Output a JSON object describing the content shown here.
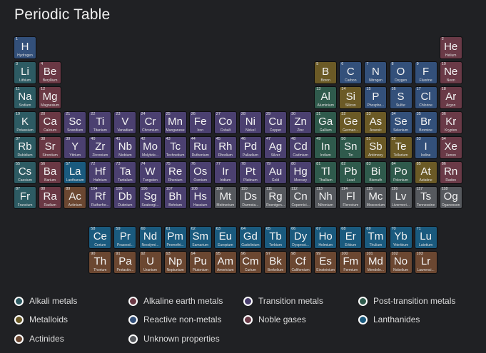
{
  "page": {
    "title": "Periodic Table"
  },
  "colors": {
    "alkali": "#2d5b63",
    "alkaline": "#6a3844",
    "transition": "#4b4070",
    "post": "#2f5a4c",
    "metalloid": "#6b5a26",
    "nonmetal": "#33507a",
    "noble": "#6a3a47",
    "lanthanide": "#1a5a7e",
    "actinide": "#6b4731",
    "unknown": "#56595e"
  },
  "legend": [
    {
      "label": "Alkali metals",
      "category": "alkali"
    },
    {
      "label": "Alkaline earth metals",
      "category": "alkaline"
    },
    {
      "label": "Transition metals",
      "category": "transition"
    },
    {
      "label": "Post-transition metals",
      "category": "post"
    },
    {
      "label": "Metalloids",
      "category": "metalloid"
    },
    {
      "label": "Reactive non-metals",
      "category": "nonmetal"
    },
    {
      "label": "Noble gases",
      "category": "noble"
    },
    {
      "label": "Lanthanides",
      "category": "lanthanide"
    },
    {
      "label": "Actinides",
      "category": "actinide"
    },
    {
      "label": "Unknown properties",
      "category": "unknown"
    }
  ],
  "elements": [
    {
      "n": 1,
      "s": "H",
      "name": "Hydrogen",
      "g": 1,
      "p": 1,
      "c": "nonmetal"
    },
    {
      "n": 2,
      "s": "He",
      "name": "Helium",
      "g": 18,
      "p": 1,
      "c": "noble"
    },
    {
      "n": 3,
      "s": "Li",
      "name": "Lithium",
      "g": 1,
      "p": 2,
      "c": "alkali"
    },
    {
      "n": 4,
      "s": "Be",
      "name": "Beryllium",
      "g": 2,
      "p": 2,
      "c": "alkaline"
    },
    {
      "n": 5,
      "s": "B",
      "name": "Boron",
      "g": 13,
      "p": 2,
      "c": "metalloid"
    },
    {
      "n": 6,
      "s": "C",
      "name": "Carbon",
      "g": 14,
      "p": 2,
      "c": "nonmetal"
    },
    {
      "n": 7,
      "s": "N",
      "name": "Nitrogen",
      "g": 15,
      "p": 2,
      "c": "nonmetal"
    },
    {
      "n": 8,
      "s": "O",
      "name": "Oxygen",
      "g": 16,
      "p": 2,
      "c": "nonmetal"
    },
    {
      "n": 9,
      "s": "F",
      "name": "Fluorine",
      "g": 17,
      "p": 2,
      "c": "nonmetal"
    },
    {
      "n": 10,
      "s": "Ne",
      "name": "Neon",
      "g": 18,
      "p": 2,
      "c": "noble"
    },
    {
      "n": 11,
      "s": "Na",
      "name": "Sodium",
      "g": 1,
      "p": 3,
      "c": "alkali"
    },
    {
      "n": 12,
      "s": "Mg",
      "name": "Magnesium",
      "g": 2,
      "p": 3,
      "c": "alkaline"
    },
    {
      "n": 13,
      "s": "Al",
      "name": "Aluminium",
      "g": 13,
      "p": 3,
      "c": "post"
    },
    {
      "n": 14,
      "s": "Si",
      "name": "Silicon",
      "g": 14,
      "p": 3,
      "c": "metalloid"
    },
    {
      "n": 15,
      "s": "P",
      "name": "Phospho...",
      "g": 15,
      "p": 3,
      "c": "nonmetal"
    },
    {
      "n": 16,
      "s": "S",
      "name": "Sulfur",
      "g": 16,
      "p": 3,
      "c": "nonmetal"
    },
    {
      "n": 17,
      "s": "Cl",
      "name": "Chlorine",
      "g": 17,
      "p": 3,
      "c": "nonmetal"
    },
    {
      "n": 18,
      "s": "Ar",
      "name": "Argon",
      "g": 18,
      "p": 3,
      "c": "noble"
    },
    {
      "n": 19,
      "s": "K",
      "name": "Potassium",
      "g": 1,
      "p": 4,
      "c": "alkali"
    },
    {
      "n": 20,
      "s": "Ca",
      "name": "Calcium",
      "g": 2,
      "p": 4,
      "c": "alkaline"
    },
    {
      "n": 21,
      "s": "Sc",
      "name": "Scandium",
      "g": 3,
      "p": 4,
      "c": "transition"
    },
    {
      "n": 22,
      "s": "Ti",
      "name": "Titanium",
      "g": 4,
      "p": 4,
      "c": "transition"
    },
    {
      "n": 23,
      "s": "V",
      "name": "Vanadium",
      "g": 5,
      "p": 4,
      "c": "transition"
    },
    {
      "n": 24,
      "s": "Cr",
      "name": "Chromium",
      "g": 6,
      "p": 4,
      "c": "transition"
    },
    {
      "n": 25,
      "s": "Mn",
      "name": "Manganese",
      "g": 7,
      "p": 4,
      "c": "transition"
    },
    {
      "n": 26,
      "s": "Fe",
      "name": "Iron",
      "g": 8,
      "p": 4,
      "c": "transition"
    },
    {
      "n": 27,
      "s": "Co",
      "name": "Cobalt",
      "g": 9,
      "p": 4,
      "c": "transition"
    },
    {
      "n": 28,
      "s": "Ni",
      "name": "Nickel",
      "g": 10,
      "p": 4,
      "c": "transition"
    },
    {
      "n": 29,
      "s": "Cu",
      "name": "Copper",
      "g": 11,
      "p": 4,
      "c": "transition"
    },
    {
      "n": 30,
      "s": "Zn",
      "name": "Zinc",
      "g": 12,
      "p": 4,
      "c": "transition"
    },
    {
      "n": 31,
      "s": "Ga",
      "name": "Gallium",
      "g": 13,
      "p": 4,
      "c": "post"
    },
    {
      "n": 32,
      "s": "Ge",
      "name": "German...",
      "g": 14,
      "p": 4,
      "c": "metalloid"
    },
    {
      "n": 33,
      "s": "As",
      "name": "Arsenic",
      "g": 15,
      "p": 4,
      "c": "metalloid"
    },
    {
      "n": 34,
      "s": "Se",
      "name": "Selenium",
      "g": 16,
      "p": 4,
      "c": "nonmetal"
    },
    {
      "n": 35,
      "s": "Br",
      "name": "Bromine",
      "g": 17,
      "p": 4,
      "c": "nonmetal"
    },
    {
      "n": 36,
      "s": "Kr",
      "name": "Krypton",
      "g": 18,
      "p": 4,
      "c": "noble"
    },
    {
      "n": 37,
      "s": "Rb",
      "name": "Rubidium",
      "g": 1,
      "p": 5,
      "c": "alkali"
    },
    {
      "n": 38,
      "s": "Sr",
      "name": "Strontium",
      "g": 2,
      "p": 5,
      "c": "alkaline"
    },
    {
      "n": 39,
      "s": "Y",
      "name": "Yttrium",
      "g": 3,
      "p": 5,
      "c": "transition"
    },
    {
      "n": 40,
      "s": "Zr",
      "name": "Zirconium",
      "g": 4,
      "p": 5,
      "c": "transition"
    },
    {
      "n": 41,
      "s": "Nb",
      "name": "Niobium",
      "g": 5,
      "p": 5,
      "c": "transition"
    },
    {
      "n": 42,
      "s": "Mo",
      "name": "Molybde...",
      "g": 6,
      "p": 5,
      "c": "transition"
    },
    {
      "n": 43,
      "s": "Tc",
      "name": "Technetium",
      "g": 7,
      "p": 5,
      "c": "transition"
    },
    {
      "n": 44,
      "s": "Ru",
      "name": "Ruthenium",
      "g": 8,
      "p": 5,
      "c": "transition"
    },
    {
      "n": 45,
      "s": "Rh",
      "name": "Rhodium",
      "g": 9,
      "p": 5,
      "c": "transition"
    },
    {
      "n": 46,
      "s": "Pd",
      "name": "Palladium",
      "g": 10,
      "p": 5,
      "c": "transition"
    },
    {
      "n": 47,
      "s": "Ag",
      "name": "Silver",
      "g": 11,
      "p": 5,
      "c": "transition"
    },
    {
      "n": 48,
      "s": "Cd",
      "name": "Cadmium",
      "g": 12,
      "p": 5,
      "c": "transition"
    },
    {
      "n": 49,
      "s": "In",
      "name": "Indium",
      "g": 13,
      "p": 5,
      "c": "post"
    },
    {
      "n": 50,
      "s": "Sn",
      "name": "Tin",
      "g": 14,
      "p": 5,
      "c": "post"
    },
    {
      "n": 51,
      "s": "Sb",
      "name": "Antimony",
      "g": 15,
      "p": 5,
      "c": "metalloid"
    },
    {
      "n": 52,
      "s": "Te",
      "name": "Tellurium",
      "g": 16,
      "p": 5,
      "c": "metalloid"
    },
    {
      "n": 53,
      "s": "I",
      "name": "Iodine",
      "g": 17,
      "p": 5,
      "c": "nonmetal"
    },
    {
      "n": 54,
      "s": "Xe",
      "name": "Xenon",
      "g": 18,
      "p": 5,
      "c": "noble"
    },
    {
      "n": 55,
      "s": "Cs",
      "name": "Caesium",
      "g": 1,
      "p": 6,
      "c": "alkali"
    },
    {
      "n": 56,
      "s": "Ba",
      "name": "Barium",
      "g": 2,
      "p": 6,
      "c": "alkaline"
    },
    {
      "n": 57,
      "s": "La",
      "name": "Lanthanum",
      "g": 3,
      "p": 6,
      "c": "lanthanide"
    },
    {
      "n": 72,
      "s": "Hf",
      "name": "Hafnium",
      "g": 4,
      "p": 6,
      "c": "transition"
    },
    {
      "n": 73,
      "s": "Ta",
      "name": "Tantalum",
      "g": 5,
      "p": 6,
      "c": "transition"
    },
    {
      "n": 74,
      "s": "W",
      "name": "Tungsten",
      "g": 6,
      "p": 6,
      "c": "transition"
    },
    {
      "n": 75,
      "s": "Re",
      "name": "Rhenium",
      "g": 7,
      "p": 6,
      "c": "transition"
    },
    {
      "n": 76,
      "s": "Os",
      "name": "Osmium",
      "g": 8,
      "p": 6,
      "c": "transition"
    },
    {
      "n": 77,
      "s": "Ir",
      "name": "Iridium",
      "g": 9,
      "p": 6,
      "c": "transition"
    },
    {
      "n": 78,
      "s": "Pt",
      "name": "Platinum",
      "g": 10,
      "p": 6,
      "c": "transition"
    },
    {
      "n": 79,
      "s": "Au",
      "name": "Gold",
      "g": 11,
      "p": 6,
      "c": "transition"
    },
    {
      "n": 80,
      "s": "Hg",
      "name": "Mercury",
      "g": 12,
      "p": 6,
      "c": "transition"
    },
    {
      "n": 81,
      "s": "Tl",
      "name": "Thallium",
      "g": 13,
      "p": 6,
      "c": "post"
    },
    {
      "n": 82,
      "s": "Pb",
      "name": "Lead",
      "g": 14,
      "p": 6,
      "c": "post"
    },
    {
      "n": 83,
      "s": "Bi",
      "name": "Bismuth",
      "g": 15,
      "p": 6,
      "c": "post"
    },
    {
      "n": 84,
      "s": "Po",
      "name": "Polonium",
      "g": 16,
      "p": 6,
      "c": "post"
    },
    {
      "n": 85,
      "s": "At",
      "name": "Astatine",
      "g": 17,
      "p": 6,
      "c": "metalloid"
    },
    {
      "n": 86,
      "s": "Rn",
      "name": "Radon",
      "g": 18,
      "p": 6,
      "c": "noble"
    },
    {
      "n": 87,
      "s": "Fr",
      "name": "Francium",
      "g": 1,
      "p": 7,
      "c": "alkali"
    },
    {
      "n": 88,
      "s": "Ra",
      "name": "Radium",
      "g": 2,
      "p": 7,
      "c": "alkaline"
    },
    {
      "n": 89,
      "s": "Ac",
      "name": "Actinium",
      "g": 3,
      "p": 7,
      "c": "actinide"
    },
    {
      "n": 104,
      "s": "Rf",
      "name": "Rutherfor...",
      "g": 4,
      "p": 7,
      "c": "transition"
    },
    {
      "n": 105,
      "s": "Db",
      "name": "Dubnium",
      "g": 5,
      "p": 7,
      "c": "transition"
    },
    {
      "n": 106,
      "s": "Sg",
      "name": "Seaborgi...",
      "g": 6,
      "p": 7,
      "c": "transition"
    },
    {
      "n": 107,
      "s": "Bh",
      "name": "Bohrium",
      "g": 7,
      "p": 7,
      "c": "transition"
    },
    {
      "n": 108,
      "s": "Hs",
      "name": "Hassium",
      "g": 8,
      "p": 7,
      "c": "transition"
    },
    {
      "n": 109,
      "s": "Mt",
      "name": "Meitnerium",
      "g": 9,
      "p": 7,
      "c": "unknown"
    },
    {
      "n": 110,
      "s": "Ds",
      "name": "Darmsta...",
      "g": 10,
      "p": 7,
      "c": "unknown"
    },
    {
      "n": 111,
      "s": "Rg",
      "name": "Roentgen...",
      "g": 11,
      "p": 7,
      "c": "unknown"
    },
    {
      "n": 112,
      "s": "Cn",
      "name": "Copernici...",
      "g": 12,
      "p": 7,
      "c": "unknown"
    },
    {
      "n": 113,
      "s": "Nh",
      "name": "Nihonium",
      "g": 13,
      "p": 7,
      "c": "unknown"
    },
    {
      "n": 114,
      "s": "Fl",
      "name": "Flerovium",
      "g": 14,
      "p": 7,
      "c": "unknown"
    },
    {
      "n": 115,
      "s": "Mc",
      "name": "Moscovium",
      "g": 15,
      "p": 7,
      "c": "unknown"
    },
    {
      "n": 116,
      "s": "Lv",
      "name": "Livermori...",
      "g": 16,
      "p": 7,
      "c": "unknown"
    },
    {
      "n": 117,
      "s": "Ts",
      "name": "Tennessine",
      "g": 17,
      "p": 7,
      "c": "unknown"
    },
    {
      "n": 118,
      "s": "Og",
      "name": "Oganesson",
      "g": 18,
      "p": 7,
      "c": "unknown"
    },
    {
      "n": 58,
      "s": "Ce",
      "name": "Cerium",
      "g": 4,
      "p": 9,
      "c": "lanthanide"
    },
    {
      "n": 59,
      "s": "Pr",
      "name": "Praseod...",
      "g": 5,
      "p": 9,
      "c": "lanthanide"
    },
    {
      "n": 60,
      "s": "Nd",
      "name": "Neodymi...",
      "g": 6,
      "p": 9,
      "c": "lanthanide"
    },
    {
      "n": 61,
      "s": "Pm",
      "name": "Promethi...",
      "g": 7,
      "p": 9,
      "c": "lanthanide"
    },
    {
      "n": 62,
      "s": "Sm",
      "name": "Samarium",
      "g": 8,
      "p": 9,
      "c": "lanthanide"
    },
    {
      "n": 63,
      "s": "Eu",
      "name": "Europium",
      "g": 9,
      "p": 9,
      "c": "lanthanide"
    },
    {
      "n": 64,
      "s": "Gd",
      "name": "Gadolinium",
      "g": 10,
      "p": 9,
      "c": "lanthanide"
    },
    {
      "n": 65,
      "s": "Tb",
      "name": "Terbium",
      "g": 11,
      "p": 9,
      "c": "lanthanide"
    },
    {
      "n": 66,
      "s": "Dy",
      "name": "Dysprosi...",
      "g": 12,
      "p": 9,
      "c": "lanthanide"
    },
    {
      "n": 67,
      "s": "Ho",
      "name": "Holmium",
      "g": 13,
      "p": 9,
      "c": "lanthanide"
    },
    {
      "n": 68,
      "s": "Er",
      "name": "Erbium",
      "g": 14,
      "p": 9,
      "c": "lanthanide"
    },
    {
      "n": 69,
      "s": "Tm",
      "name": "Thulium",
      "g": 15,
      "p": 9,
      "c": "lanthanide"
    },
    {
      "n": 70,
      "s": "Yb",
      "name": "Ytterbium",
      "g": 16,
      "p": 9,
      "c": "lanthanide"
    },
    {
      "n": 71,
      "s": "Lu",
      "name": "Lutetium",
      "g": 17,
      "p": 9,
      "c": "lanthanide"
    },
    {
      "n": 90,
      "s": "Th",
      "name": "Thorium",
      "g": 4,
      "p": 10,
      "c": "actinide"
    },
    {
      "n": 91,
      "s": "Pa",
      "name": "Protactin...",
      "g": 5,
      "p": 10,
      "c": "actinide"
    },
    {
      "n": 92,
      "s": "U",
      "name": "Uranium",
      "g": 6,
      "p": 10,
      "c": "actinide"
    },
    {
      "n": 93,
      "s": "Np",
      "name": "Neptunium",
      "g": 7,
      "p": 10,
      "c": "actinide"
    },
    {
      "n": 94,
      "s": "Pu",
      "name": "Plutonium",
      "g": 8,
      "p": 10,
      "c": "actinide"
    },
    {
      "n": 95,
      "s": "Am",
      "name": "Americium",
      "g": 9,
      "p": 10,
      "c": "actinide"
    },
    {
      "n": 96,
      "s": "Cm",
      "name": "Curium",
      "g": 10,
      "p": 10,
      "c": "actinide"
    },
    {
      "n": 97,
      "s": "Bk",
      "name": "Berkelium",
      "g": 11,
      "p": 10,
      "c": "actinide"
    },
    {
      "n": 98,
      "s": "Cf",
      "name": "Californium",
      "g": 12,
      "p": 10,
      "c": "actinide"
    },
    {
      "n": 99,
      "s": "Es",
      "name": "Einsteinium",
      "g": 13,
      "p": 10,
      "c": "actinide"
    },
    {
      "n": 100,
      "s": "Fm",
      "name": "Fermium",
      "g": 14,
      "p": 10,
      "c": "actinide"
    },
    {
      "n": 101,
      "s": "Md",
      "name": "Mendele...",
      "g": 15,
      "p": 10,
      "c": "actinide"
    },
    {
      "n": 102,
      "s": "No",
      "name": "Nobelium",
      "g": 16,
      "p": 10,
      "c": "actinide"
    },
    {
      "n": 103,
      "s": "Lr",
      "name": "Lawrenci...",
      "g": 17,
      "p": 10,
      "c": "actinide"
    }
  ]
}
